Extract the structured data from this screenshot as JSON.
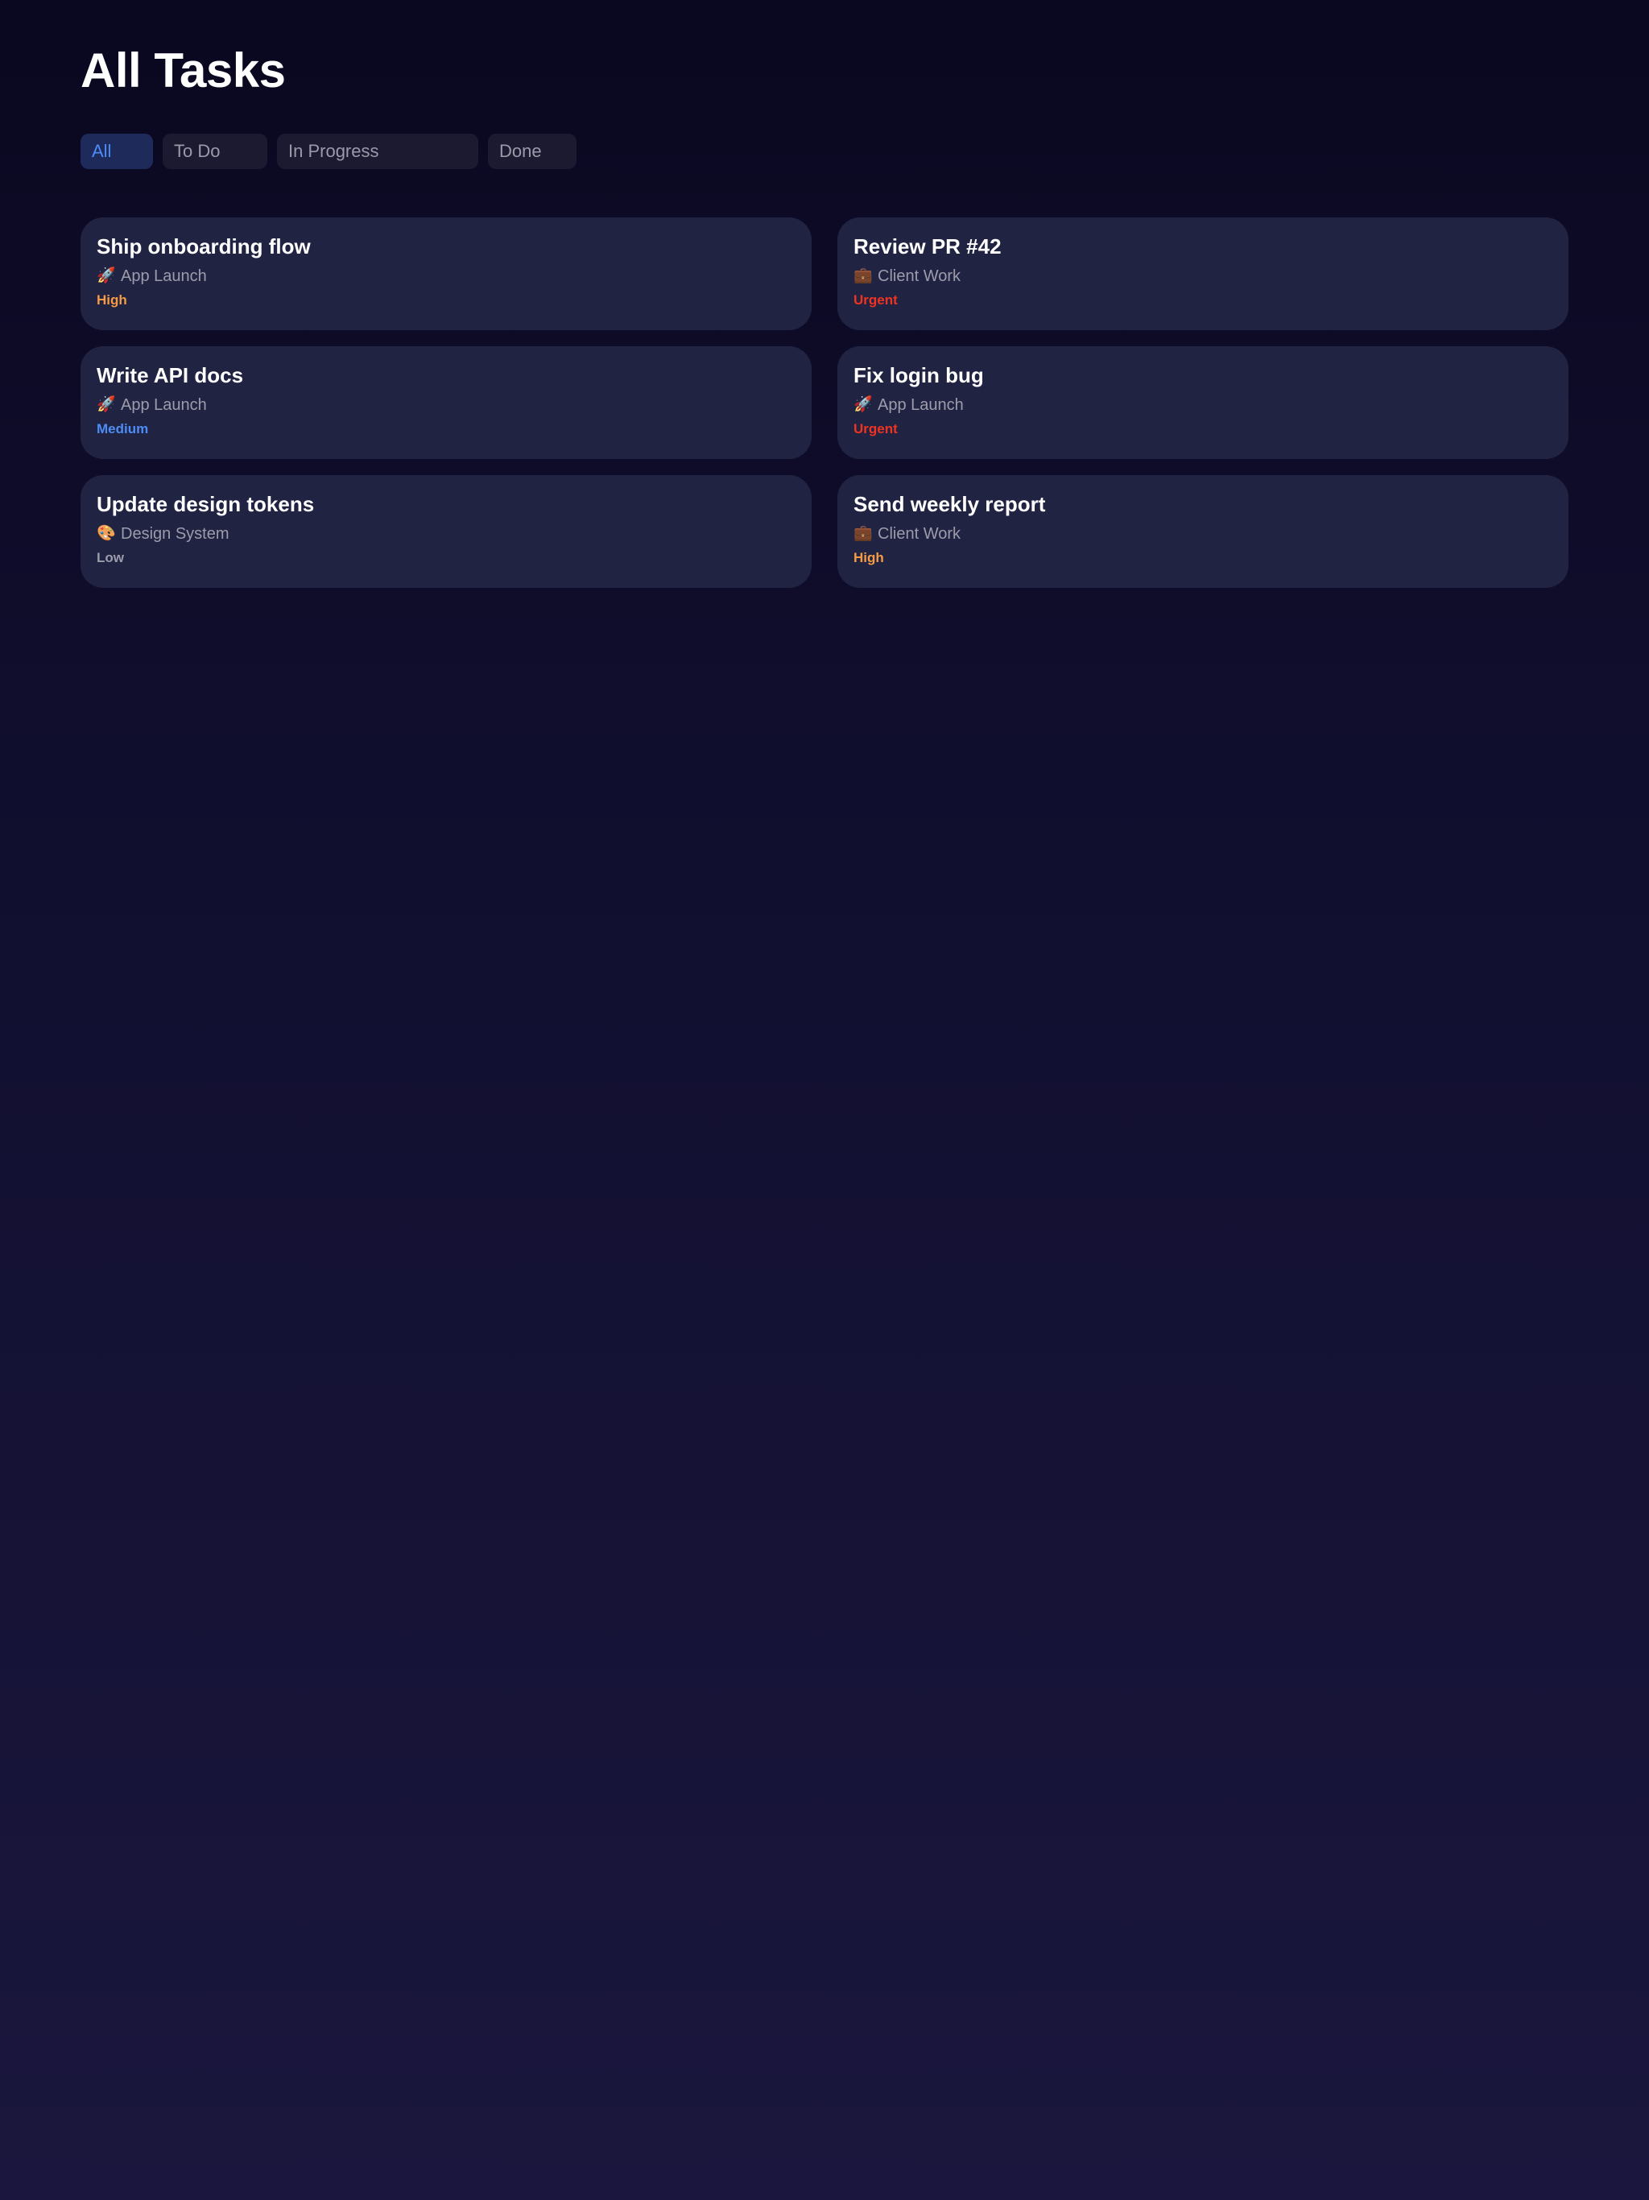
{
  "header": {
    "title": "All Tasks"
  },
  "filters": [
    {
      "label": "All",
      "active": true
    },
    {
      "label": "To Do",
      "active": false
    },
    {
      "label": "In Progress",
      "active": false
    },
    {
      "label": "Done",
      "active": false
    }
  ],
  "tasks": [
    {
      "title": "Ship onboarding flow",
      "project_icon": "🚀",
      "project_icon_name": "rocket-icon",
      "project": "App Launch",
      "priority": "High"
    },
    {
      "title": "Review PR #42",
      "project_icon": "💼",
      "project_icon_name": "briefcase-icon",
      "project": "Client Work",
      "priority": "Urgent"
    },
    {
      "title": "Write API docs",
      "project_icon": "🚀",
      "project_icon_name": "rocket-icon",
      "project": "App Launch",
      "priority": "Medium"
    },
    {
      "title": "Fix login bug",
      "project_icon": "🚀",
      "project_icon_name": "rocket-icon",
      "project": "App Launch",
      "priority": "Urgent"
    },
    {
      "title": "Update design tokens",
      "project_icon": "🎨",
      "project_icon_name": "palette-icon",
      "project": "Design System",
      "priority": "Low"
    },
    {
      "title": "Send weekly report",
      "project_icon": "💼",
      "project_icon_name": "briefcase-icon",
      "project": "Client Work",
      "priority": "High"
    }
  ],
  "priority_colors": {
    "High": "#f59a45",
    "Urgent": "#ee3322",
    "Medium": "#4d8cf5",
    "Low": "#9c9cad"
  },
  "colors": {
    "background_top": "#0a0820",
    "background_bottom": "#1a163d",
    "card": "#212342",
    "accent": "#4d8cf5",
    "chip": "#1c1a30",
    "chip_active": "#1e2a5a"
  }
}
